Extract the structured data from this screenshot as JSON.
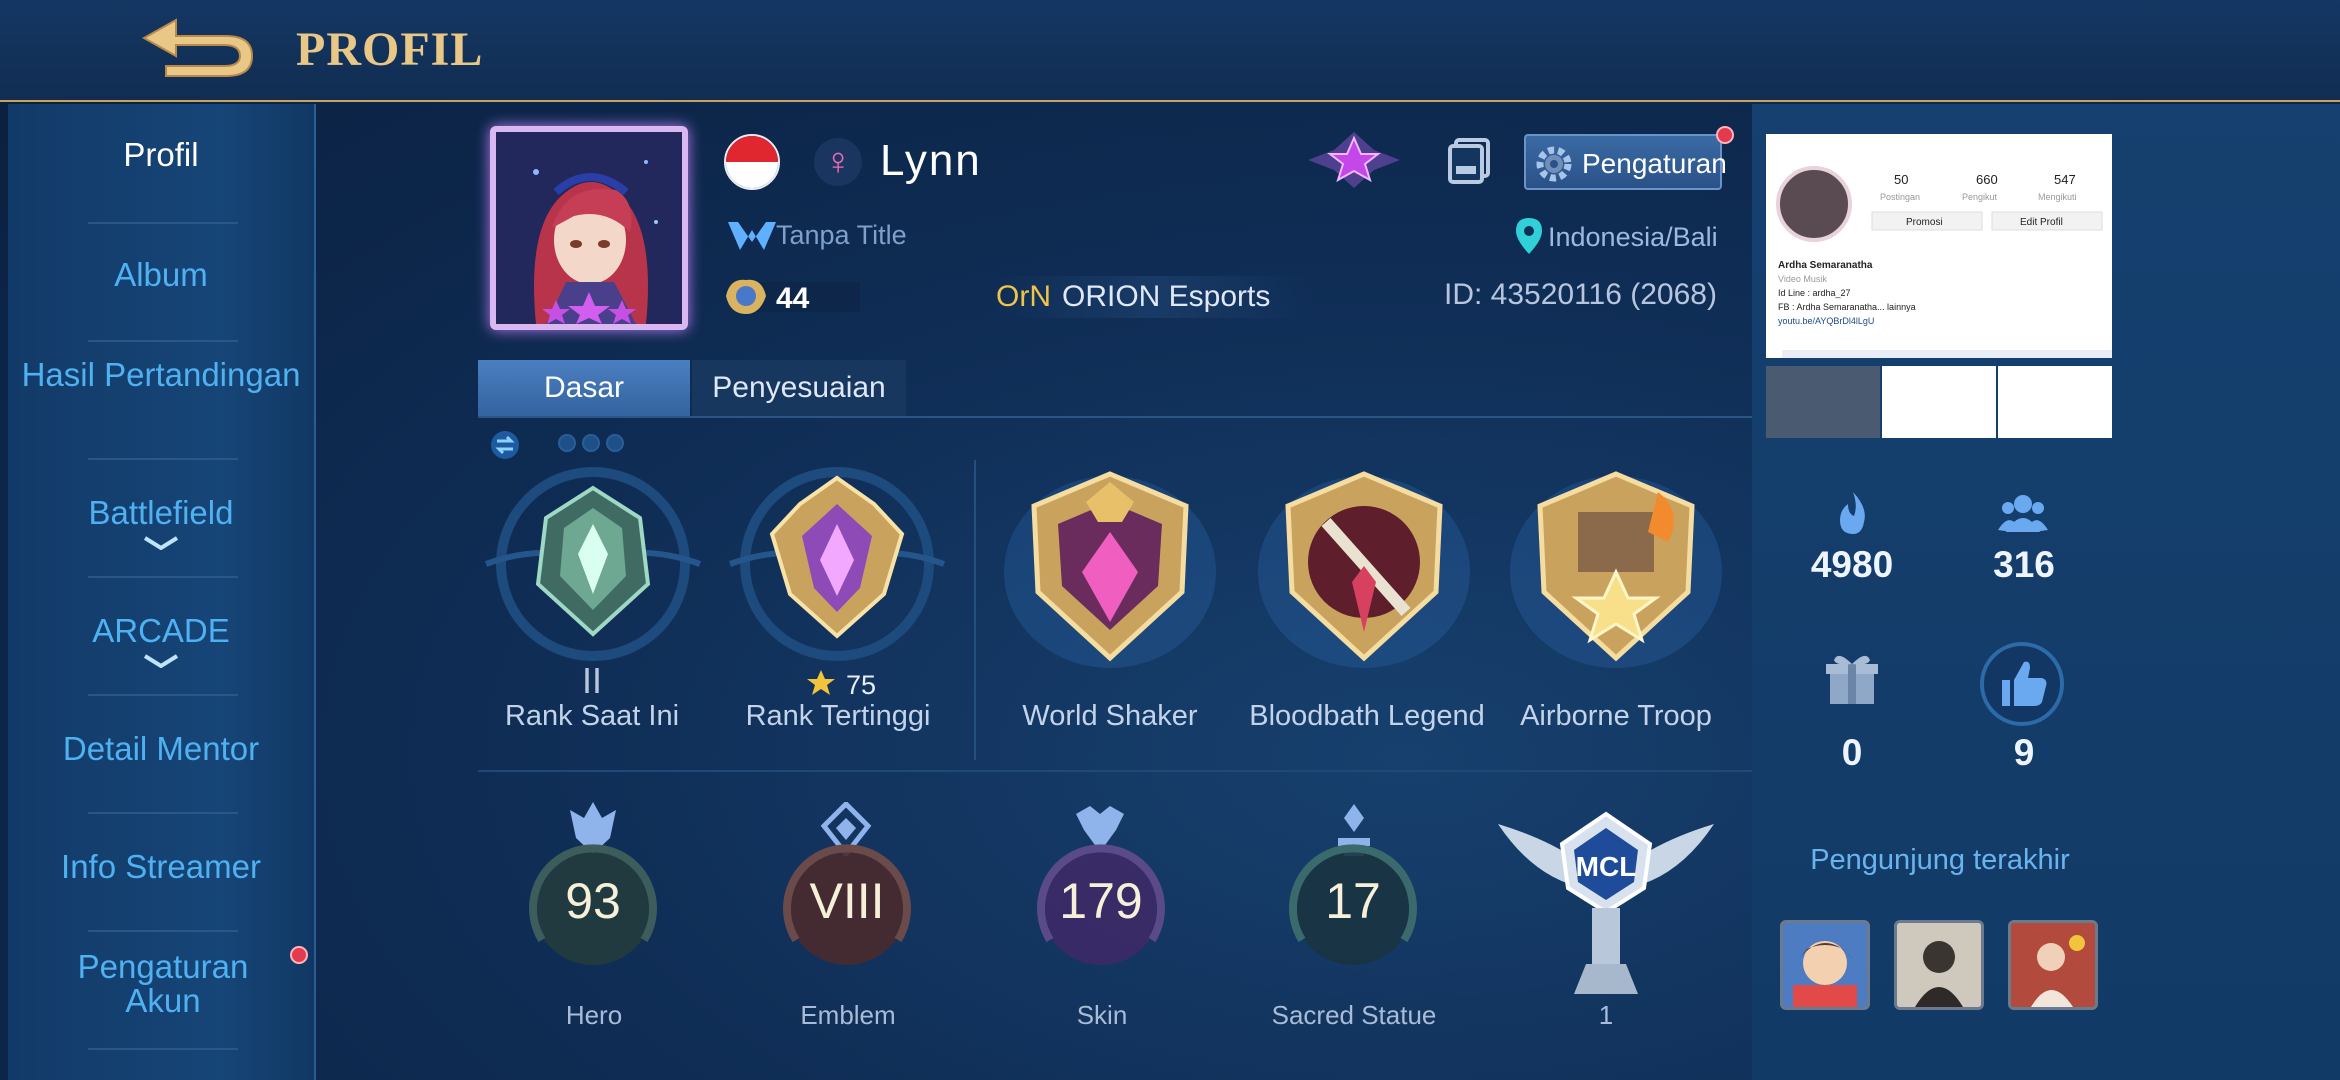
{
  "header": {
    "title": "PROFIL"
  },
  "sidebar": {
    "items": [
      {
        "label": "Profil"
      },
      {
        "label": "Album"
      },
      {
        "label": "Hasil Pertandingan"
      },
      {
        "label": "Battlefield"
      },
      {
        "label": "ARCADE"
      },
      {
        "label": "Detail Mentor"
      },
      {
        "label": "Info Streamer"
      },
      {
        "label": "Pengaturan Akun"
      }
    ]
  },
  "profile": {
    "name": "Lynn",
    "title": "Tanpa Title",
    "level": "44",
    "squad_tag": "OrN",
    "squad_name": "ORION Esports",
    "settings_label": "Pengaturan",
    "location": "Indonesia/Bali",
    "id_text": "ID: 43520116 (2068)"
  },
  "tabs": [
    {
      "label": "Dasar"
    },
    {
      "label": "Penyesuaian"
    }
  ],
  "achievements": [
    {
      "label": "Rank Saat Ini",
      "sub": "II"
    },
    {
      "label": "Rank Tertinggi",
      "sub": "75"
    },
    {
      "label": "World Shaker"
    },
    {
      "label": "Bloodbath Legend"
    },
    {
      "label": "Airborne Troop"
    }
  ],
  "stats": [
    {
      "label": "Hero",
      "value": "93"
    },
    {
      "label": "Emblem",
      "value": "VIII"
    },
    {
      "label": "Skin",
      "value": "179"
    },
    {
      "label": "Sacred Statue",
      "value": "17"
    },
    {
      "label": "1"
    }
  ],
  "mcl_text": "MCL",
  "right_stats": {
    "popularity": "4980",
    "followers": "316",
    "gifts": "0",
    "likes": "9"
  },
  "album_preview": {
    "stats": [
      "50",
      "660",
      "547"
    ],
    "stat_labels": [
      "Postingan",
      "Pengikut",
      "Mengikuti"
    ],
    "buttons": [
      "Promosi",
      "Edit Profil"
    ],
    "lines": [
      "Ardha Semaranatha",
      "Video Musik",
      "Id Line : ardha_27",
      "FB : Ardha Semaranatha... lainnya",
      "youtu.be/AYQBrDl4lLgU"
    ]
  },
  "visitors_label": "Pengunjung terakhir",
  "colors": {
    "accent_gold": "#e9c887",
    "sidebar_text": "#4fb1f2",
    "bg": "#0f2d55"
  }
}
